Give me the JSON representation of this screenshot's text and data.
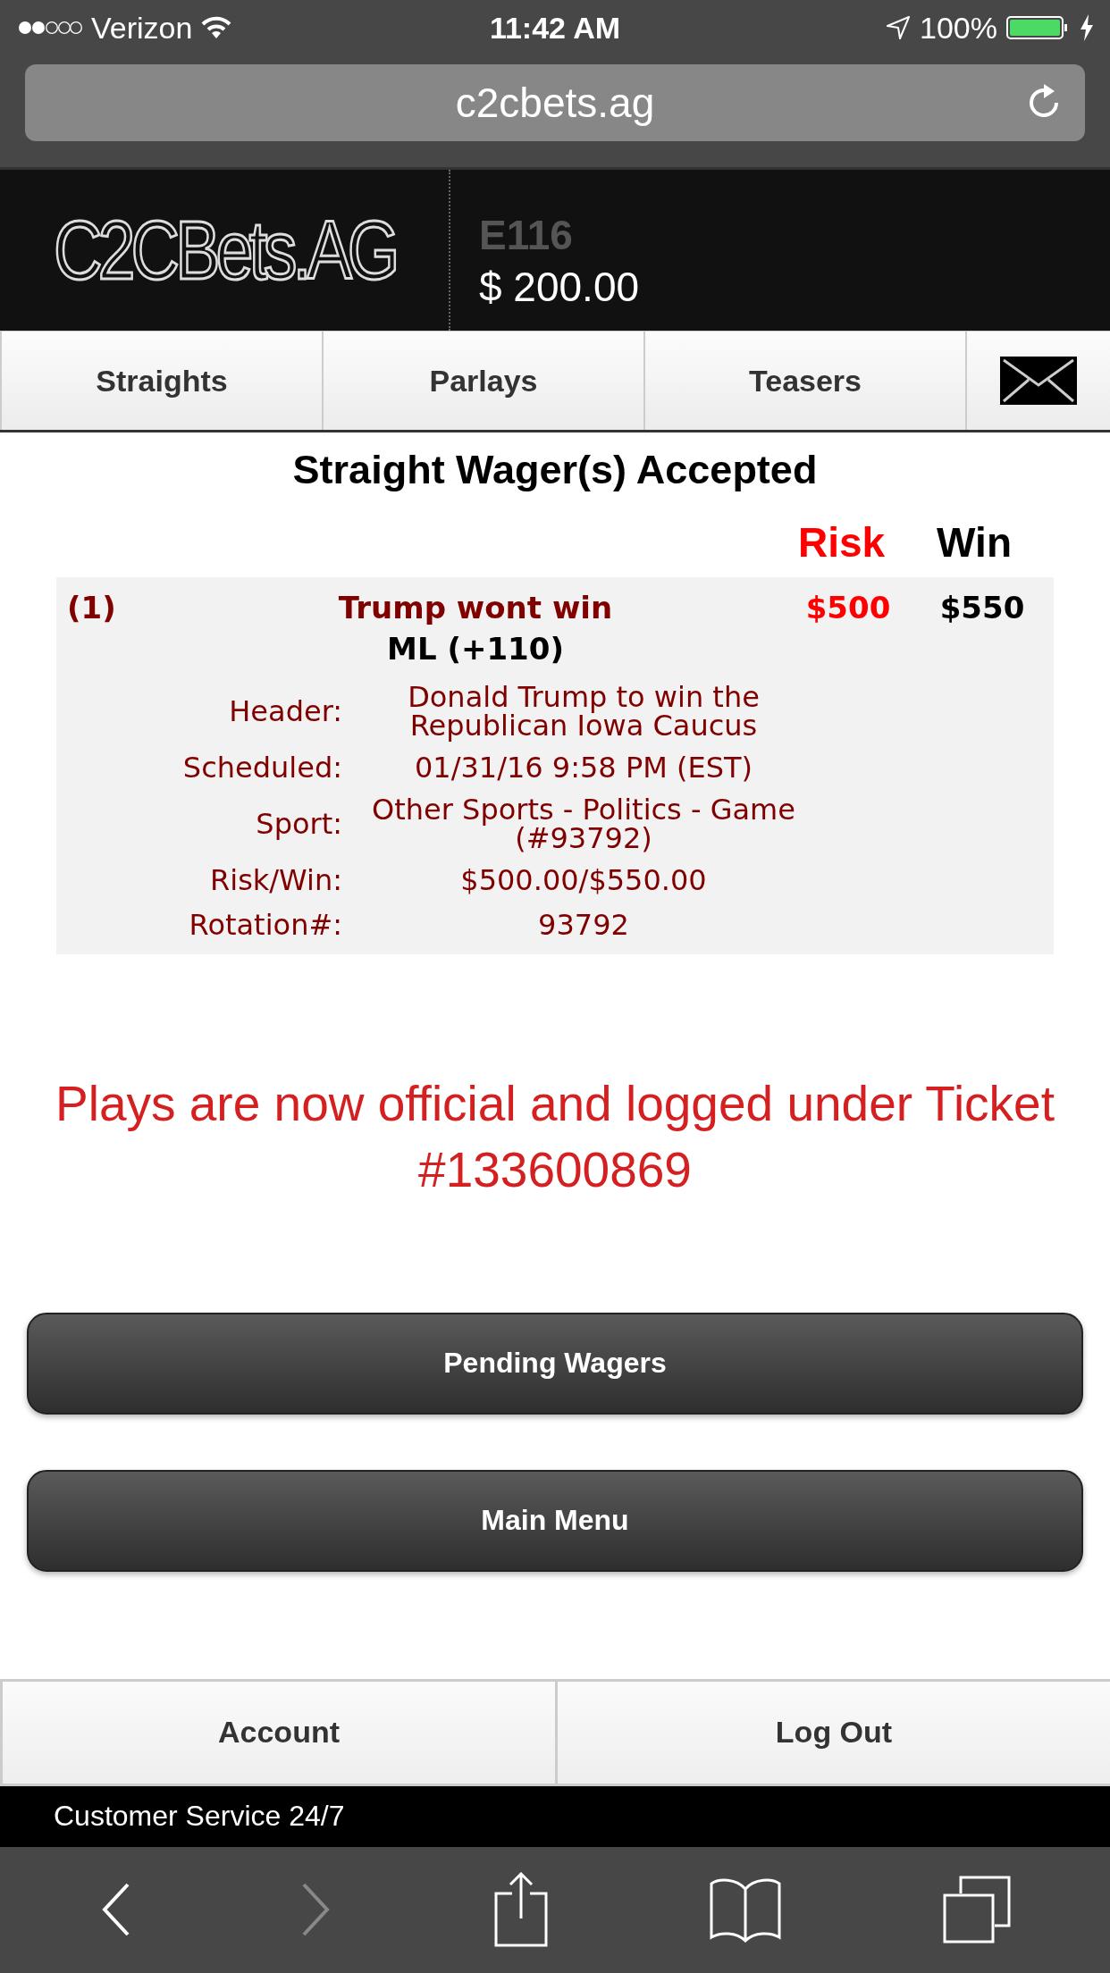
{
  "status_bar": {
    "carrier": "Verizon",
    "time": "11:42 AM",
    "battery": "100%"
  },
  "browser": {
    "url": "c2cbets.ag"
  },
  "header": {
    "logo": "C2CBets.AG",
    "account_id": "E116",
    "balance": "$ 200.00"
  },
  "tabs": [
    "Straights",
    "Parlays",
    "Teasers"
  ],
  "confirmation": {
    "title": "Straight Wager(s) Accepted",
    "risk_heading": "Risk",
    "win_heading": "Win",
    "wagers": [
      {
        "number": "(1)",
        "selection": "Trump wont win",
        "line": "ML (+110)",
        "risk": "$500",
        "win": "$550",
        "details": [
          {
            "label": "Header:",
            "value": "Donald Trump to win the Republican Iowa Caucus"
          },
          {
            "label": "Scheduled:",
            "value": "01/31/16 9:58 PM (EST)"
          },
          {
            "label": "Sport:",
            "value": "Other Sports - Politics - Game (#93792)"
          },
          {
            "label": "Risk/Win:",
            "value": "$500.00/$550.00"
          },
          {
            "label": "Rotation#:",
            "value": "93792"
          }
        ]
      }
    ],
    "ticket_message": "Plays are now official and logged under Ticket #133600869"
  },
  "actions": [
    "Pending Wagers",
    "Main Menu"
  ],
  "footer_tabs": [
    "Account",
    "Log Out"
  ],
  "footer_note": "Customer Service 24/7"
}
